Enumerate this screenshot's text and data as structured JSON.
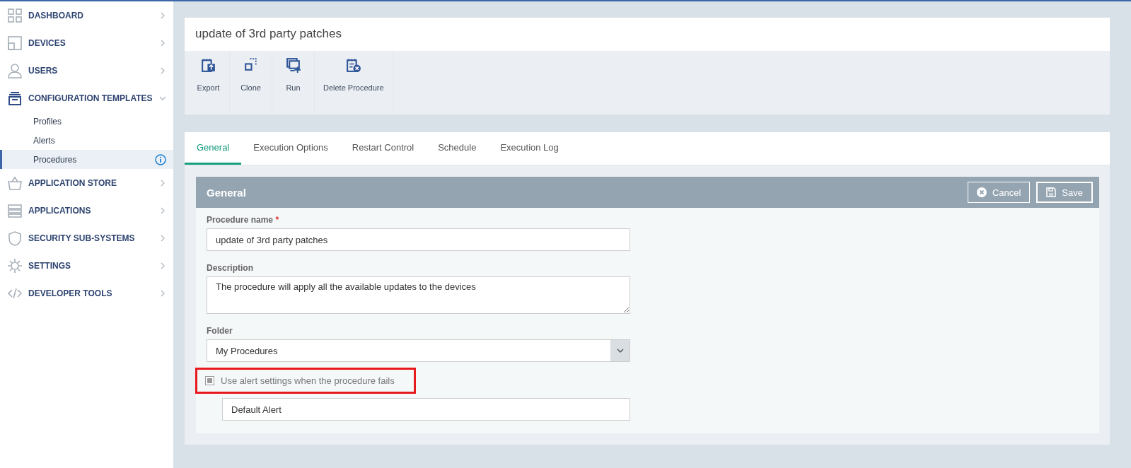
{
  "sidebar": {
    "items": [
      {
        "label": "DASHBOARD",
        "expanded": false
      },
      {
        "label": "DEVICES",
        "expanded": false
      },
      {
        "label": "USERS",
        "expanded": false
      },
      {
        "label": "CONFIGURATION TEMPLATES",
        "expanded": true,
        "children": [
          {
            "label": "Profiles",
            "selected": false
          },
          {
            "label": "Alerts",
            "selected": false
          },
          {
            "label": "Procedures",
            "selected": true
          }
        ]
      },
      {
        "label": "APPLICATION STORE",
        "expanded": false
      },
      {
        "label": "APPLICATIONS",
        "expanded": false
      },
      {
        "label": "SECURITY SUB-SYSTEMS",
        "expanded": false
      },
      {
        "label": "SETTINGS",
        "expanded": false
      },
      {
        "label": "DEVELOPER TOOLS",
        "expanded": false
      }
    ]
  },
  "page_title": "update of 3rd party patches",
  "toolbar": [
    "Export",
    "Clone",
    "Run",
    "Delete Procedure"
  ],
  "tabs": [
    {
      "label": "General",
      "selected": true
    },
    {
      "label": "Execution Options",
      "selected": false
    },
    {
      "label": "Restart Control",
      "selected": false
    },
    {
      "label": "Schedule",
      "selected": false
    },
    {
      "label": "Execution Log",
      "selected": false
    }
  ],
  "panel": {
    "title": "General",
    "buttons": [
      "Cancel",
      "Save"
    ]
  },
  "form": {
    "name_label": "Procedure name",
    "name_required": "*",
    "name_value": "update of 3rd party patches",
    "description_label": "Description",
    "description_value": "The procedure will apply all the available updates to the devices",
    "folder_label": "Folder",
    "folder_value": "My Procedures",
    "alert_checkbox": {
      "label": "Use alert settings when the procedure fails",
      "checked": true,
      "highlighted": true
    },
    "alert_value": "Default Alert"
  }
}
